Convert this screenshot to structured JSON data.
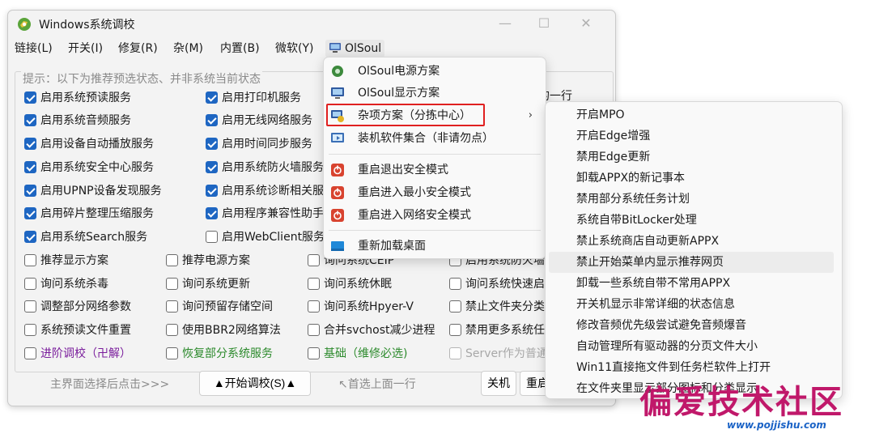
{
  "window": {
    "title": "Windows系统调校",
    "minimize_glyph": "—",
    "maximize_glyph": "☐",
    "close_glyph": "✕"
  },
  "menubar": [
    "链接(L)",
    "开关(I)",
    "修复(R)",
    "杂(M)",
    "内置(B)",
    "微软(Y)",
    "OlSoul"
  ],
  "group_label": "提示：以下为推荐预选状态、并非系统当前状态",
  "checkboxes": {
    "col1": [
      {
        "label": "启用系统预读服务",
        "checked": true
      },
      {
        "label": "启用系统音频服务",
        "checked": true
      },
      {
        "label": "启用设备自动播放服务",
        "checked": true
      },
      {
        "label": "启用系统安全中心服务",
        "checked": true
      },
      {
        "label": "启用UPNP设备发现服务",
        "checked": true
      },
      {
        "label": "启用碎片整理压缩服务",
        "checked": true
      },
      {
        "label": "启用系统Search服务",
        "checked": true
      },
      {
        "label": "推荐显示方案",
        "checked": false
      },
      {
        "label": "询问系统杀毒",
        "checked": false
      },
      {
        "label": "调整部分网络参数",
        "checked": false
      },
      {
        "label": "系统预读文件重置",
        "checked": false
      },
      {
        "label": "进阶调校（卍解）",
        "checked": false
      }
    ],
    "col2": [
      {
        "label": "启用打印机服务",
        "checked": true
      },
      {
        "label": "启用无线网络服务",
        "checked": true
      },
      {
        "label": "启用时间同步服务",
        "checked": true
      },
      {
        "label": "启用系统防火墙服务",
        "checked": true
      },
      {
        "label": "启用系统诊断相关服",
        "checked": true
      },
      {
        "label": "启用程序兼容性助手",
        "checked": true
      },
      {
        "label": "启用WebClient服务",
        "checked": false
      },
      {
        "label": "推荐电源方案",
        "checked": false
      },
      {
        "label": "询问系统更新",
        "checked": false
      },
      {
        "label": "询问预留存储空间",
        "checked": false
      },
      {
        "label": "使用BBR2网络算法",
        "checked": false
      },
      {
        "label": "恢复部分系统服务",
        "checked": false
      }
    ],
    "col3": [
      {
        "label": "询问系统CEIP",
        "checked": false
      },
      {
        "label": "询问系统休眠",
        "checked": false
      },
      {
        "label": "询问系统Hpyer-V",
        "checked": false
      },
      {
        "label": "合并svchost减少进程",
        "checked": false
      },
      {
        "label": "基础（维修必选)",
        "checked": false
      }
    ],
    "col4": [
      {
        "label": "启用系统防火墙",
        "checked": false
      },
      {
        "label": "询问系统快速启",
        "checked": false
      },
      {
        "label": "禁止文件夹分类",
        "checked": false
      },
      {
        "label": "禁用更多系统任",
        "checked": false
      },
      {
        "label": "Server作为普通",
        "checked": false
      }
    ],
    "peek_text": "的一行"
  },
  "bottom": {
    "hint_left": "主界面选择后点击>>>",
    "start_button": "▲开始调校(S)▲",
    "hint_right": "↖首选上面一行",
    "shutdown_button": "关机",
    "restart_button": "重启"
  },
  "olsoul_menu": [
    {
      "label": "OlSoul电源方案",
      "icon": "power-plan-icon"
    },
    {
      "label": "OlSoul显示方案",
      "icon": "display-plan-icon"
    },
    {
      "label": "杂项方案（分拣中心）",
      "icon": "misc-plan-icon",
      "submenu_arrow": "›"
    },
    {
      "label": "装机软件集合（非请勿点）",
      "icon": "software-pack-icon"
    },
    {
      "label": "重启退出安全模式",
      "icon": "restart-icon"
    },
    {
      "label": "重启进入最小安全模式",
      "icon": "restart-icon"
    },
    {
      "label": "重启进入网络安全模式",
      "icon": "restart-icon"
    },
    {
      "label": "重新加载桌面",
      "icon": "desktop-icon"
    }
  ],
  "submenu": [
    "开启MPO",
    "开启Edge增强",
    "禁用Edge更新",
    "卸载APPX的新记事本",
    "禁用部分系统任务计划",
    "系统自带BitLocker处理",
    "禁止系统商店自动更新APPX",
    "禁止开始菜单内显示推荐网页",
    "卸载一些系统自带不常用APPX",
    "开关机显示非常详细的状态信息",
    "修改音频优先级尝试避免音频爆音",
    "自动管理所有驱动器的分页文件大小",
    "Win11直接拖文件到任务栏软件上打开",
    "在文件夹里显示部分图标和分类显示"
  ],
  "watermark": {
    "title": "偏爱技术社区",
    "url": "www.pojjishu.com"
  },
  "colors": {
    "check_blue": "#1e66c2",
    "highlight_red": "#e02020",
    "watermark_pink": "#c0186a",
    "purple_text": "#7a1d9c",
    "green_text": "#2c8a2c"
  }
}
